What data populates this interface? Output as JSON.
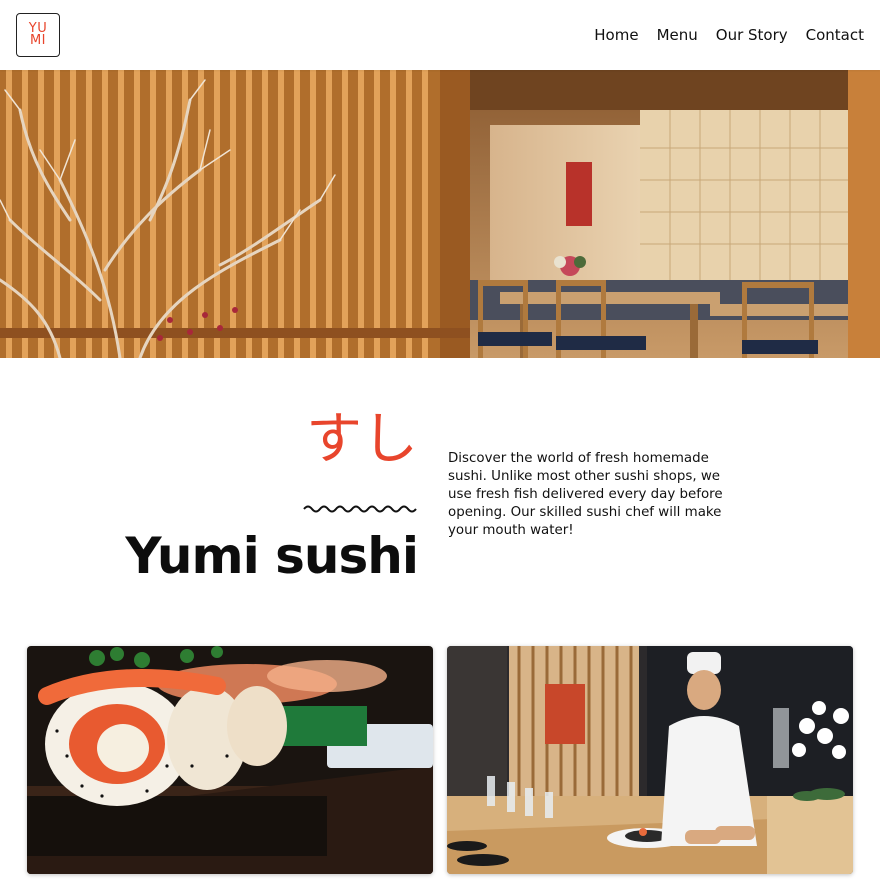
{
  "brand": {
    "logo_text": "YUMI"
  },
  "nav": {
    "items": [
      "Home",
      "Menu",
      "Our Story",
      "Contact"
    ]
  },
  "hero": {
    "image": "restaurant-interior"
  },
  "intro": {
    "japanese": "すし",
    "title": "Yumi sushi",
    "description": "Discover the world of fresh homemade sushi. Unlike most other sushi shops, we use fresh fish delivered every day before opening. Our skilled sushi chef will make your mouth water!"
  },
  "cards": [
    {
      "image": "salmon-sushi-rolls"
    },
    {
      "image": "sushi-chef-at-counter"
    }
  ],
  "colors": {
    "accent": "#e8452c",
    "text": "#111111",
    "background": "#ffffff"
  }
}
